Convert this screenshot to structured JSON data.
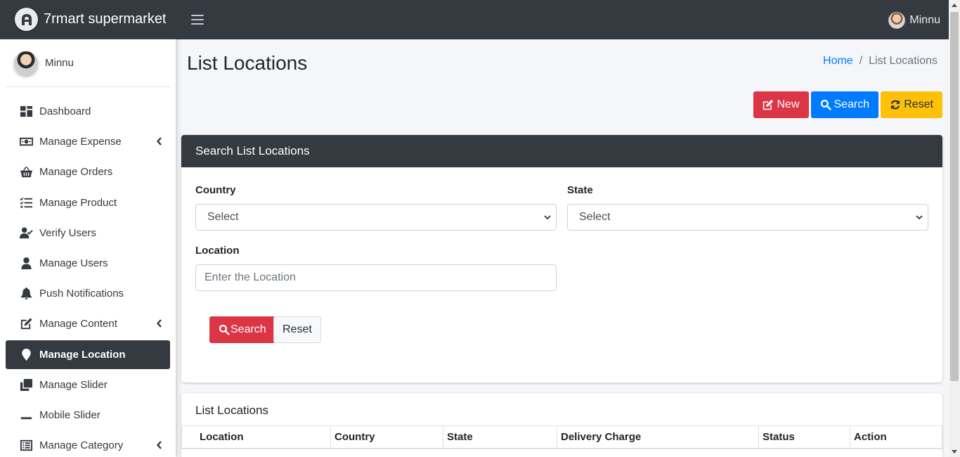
{
  "brand": {
    "title": "7rmart supermarket"
  },
  "navbar": {
    "user_name": "Minnu"
  },
  "sidebar": {
    "user_name": "Minnu",
    "items": [
      {
        "label": "Dashboard",
        "icon": "dashboard-icon",
        "has_submenu": false,
        "active": false
      },
      {
        "label": "Manage Expense",
        "icon": "money-bill-icon",
        "has_submenu": true,
        "active": false
      },
      {
        "label": "Manage Orders",
        "icon": "shopping-basket-icon",
        "has_submenu": false,
        "active": false
      },
      {
        "label": "Manage Product",
        "icon": "tasks-icon",
        "has_submenu": false,
        "active": false
      },
      {
        "label": "Verify Users",
        "icon": "user-check-icon",
        "has_submenu": false,
        "active": false
      },
      {
        "label": "Manage Users",
        "icon": "user-icon",
        "has_submenu": false,
        "active": false
      },
      {
        "label": "Push Notifications",
        "icon": "bell-icon",
        "has_submenu": false,
        "active": false
      },
      {
        "label": "Manage Content",
        "icon": "edit-icon",
        "has_submenu": true,
        "active": false
      },
      {
        "label": "Manage Location",
        "icon": "map-marker-icon",
        "has_submenu": false,
        "active": true
      },
      {
        "label": "Manage Slider",
        "icon": "clone-icon",
        "has_submenu": false,
        "active": false
      },
      {
        "label": "Mobile Slider",
        "icon": "minus-icon",
        "has_submenu": false,
        "active": false
      },
      {
        "label": "Manage Category",
        "icon": "list-alt-icon",
        "has_submenu": true,
        "active": false
      }
    ]
  },
  "page": {
    "title": "List Locations",
    "breadcrumb": {
      "home": "Home",
      "current": "List Locations"
    },
    "actions": {
      "new_label": "New",
      "search_label": "Search",
      "reset_label": "Reset"
    }
  },
  "search_card": {
    "title": "Search List Locations",
    "country": {
      "label": "Country",
      "value": "Select"
    },
    "state": {
      "label": "State",
      "value": "Select"
    },
    "location": {
      "label": "Location",
      "placeholder": "Enter the Location",
      "value": ""
    },
    "search_button": "Search",
    "reset_button": "Reset"
  },
  "list_card": {
    "title": "List Locations",
    "columns": [
      "Location",
      "Country",
      "State",
      "Delivery Charge",
      "Status",
      "Action"
    ]
  },
  "colors": {
    "dark": "#343a40",
    "danger": "#dc3545",
    "primary": "#007bff",
    "warning": "#ffc107",
    "link": "#007bff"
  }
}
